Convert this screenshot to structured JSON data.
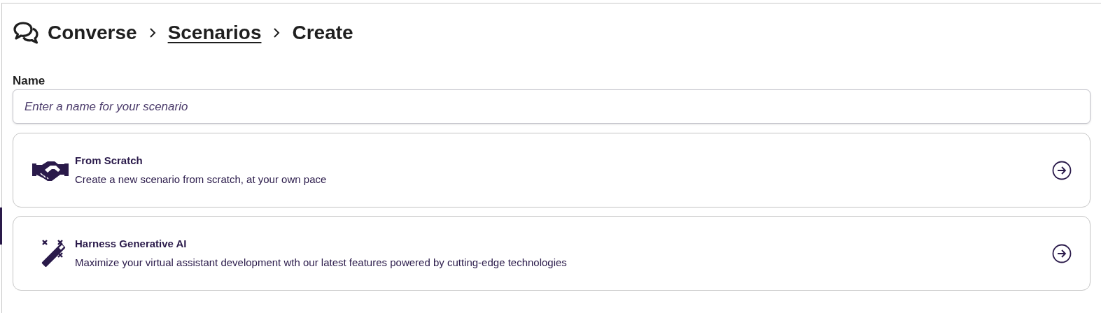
{
  "breadcrumb": [
    {
      "label": "Converse",
      "kind": "root"
    },
    {
      "label": "Scenarios",
      "kind": "link"
    },
    {
      "label": "Create",
      "kind": "current"
    }
  ],
  "name_field": {
    "label": "Name",
    "placeholder": "Enter a name for your scenario"
  },
  "options": [
    {
      "kind": "handshake",
      "title": "From Scratch",
      "description": "Create a new scenario from scratch, at your own pace"
    },
    {
      "kind": "wand",
      "title": "Harness Generative AI",
      "description": "Maximize your virtual assistant development wth our latest features powered by cutting-edge technologies"
    }
  ]
}
